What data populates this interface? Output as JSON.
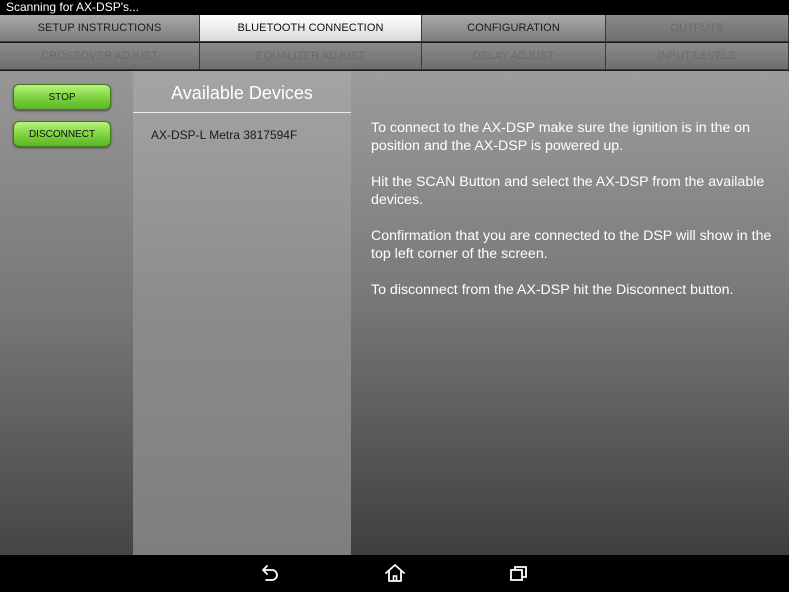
{
  "status_bar": {
    "text": "Scanning for AX-DSP's..."
  },
  "tabs": {
    "row1": [
      {
        "label": "SETUP INSTRUCTIONS",
        "state": "normal"
      },
      {
        "label": "BLUETOOTH CONNECTION",
        "state": "active"
      },
      {
        "label": "CONFIGURATION",
        "state": "normal"
      },
      {
        "label": "OUTPUTS",
        "state": "disabled"
      }
    ],
    "row2": [
      {
        "label": "CROSSOVER ADJUST",
        "state": "disabled"
      },
      {
        "label": "EQUALIZER ADJUST",
        "state": "disabled"
      },
      {
        "label": "DELAY ADJUST",
        "state": "disabled"
      },
      {
        "label": "INPUT/LEVELS",
        "state": "disabled"
      }
    ]
  },
  "sidebar": {
    "stop_label": "STOP",
    "disconnect_label": "DISCONNECT"
  },
  "devices": {
    "title": "Available Devices",
    "items": [
      "AX-DSP-L Metra 3817594F"
    ]
  },
  "instructions": {
    "paragraphs": [
      "To connect to the AX-DSP make sure the ignition is in the on position and the AX-DSP is powered up.",
      "Hit the SCAN Button and select the AX-DSP from the available devices.",
      "Confirmation that you are connected to the DSP will show in the top left corner of the screen.",
      "To disconnect from the AX-DSP hit the Disconnect button."
    ]
  },
  "nav_bar": {
    "icons": [
      "back-icon",
      "home-icon",
      "recent-apps-icon"
    ]
  },
  "colors": {
    "accent_green": "#7ad23c",
    "active_tab": "#ffffff",
    "status_bar": "#000000"
  }
}
